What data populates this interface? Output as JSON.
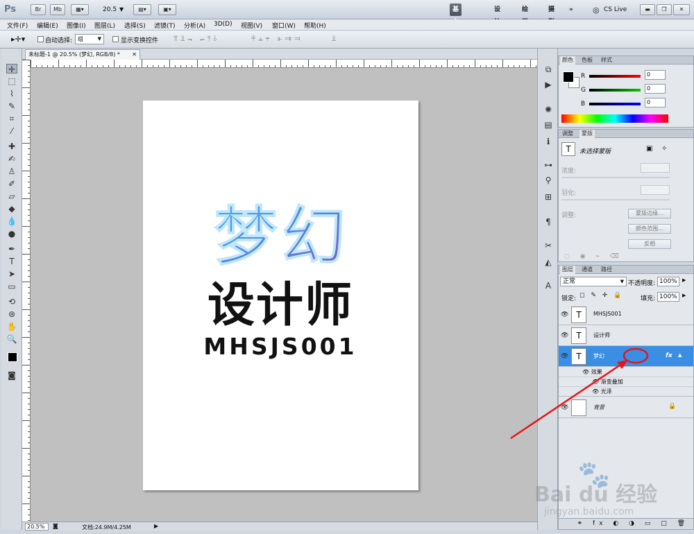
{
  "app": {
    "logo": "Ps",
    "bridge_btn": "Br",
    "minibridge_btn": "Mb",
    "zoom": "20.5",
    "workspaces": [
      "基本功能",
      "设计",
      "绘画",
      "摄影",
      "»"
    ],
    "cslive": "CS Live"
  },
  "menu": [
    "文件(F)",
    "编辑(E)",
    "图像(I)",
    "图层(L)",
    "选择(S)",
    "滤镜(T)",
    "分析(A)",
    "3D(D)",
    "视图(V)",
    "窗口(W)",
    "帮助(H)"
  ],
  "options": {
    "auto_select_label": "自动选择:",
    "auto_select_value": "组",
    "transform_label": "显示变换控件"
  },
  "document": {
    "tab_title": "未标题-1 @ 20.5% (梦幻, RGB/8) *",
    "line1": "梦幻",
    "line2": "设计师",
    "line3": "MHSJS001"
  },
  "status": {
    "zoom": "20.5%",
    "doc_info": "文档:24.9M/4.25M"
  },
  "color_panel": {
    "tabs": [
      "颜色",
      "色板",
      "样式"
    ],
    "channels": [
      {
        "label": "R",
        "value": "0"
      },
      {
        "label": "G",
        "value": "0"
      },
      {
        "label": "B",
        "value": "0"
      }
    ]
  },
  "adjust_panel": {
    "tabs": [
      "调整",
      "蒙版"
    ],
    "title": "未选择蒙版",
    "density": "浓度:",
    "feather": "羽化:",
    "refine": "调整:",
    "mask_edge": "蒙版边缘...",
    "color_range": "颜色范围...",
    "invert": "反相"
  },
  "layers_panel": {
    "tabs": [
      "图层",
      "通道",
      "路径"
    ],
    "blend_mode": "正常",
    "opacity_label": "不透明度:",
    "opacity": "100%",
    "lock_label": "锁定:",
    "fill_label": "填充:",
    "fill": "100%",
    "layers": [
      "MHSJS001",
      "设计师",
      "梦幻"
    ],
    "effects_label": "效果",
    "effects": [
      "渐变叠加",
      "光泽"
    ],
    "background": "背景",
    "fx": "fx"
  },
  "watermark": {
    "brand": "Bai du 经验",
    "url": "jingyan.baidu.com"
  },
  "colors": {
    "selected_layer": "#3a8fe4",
    "annotation": "#e8141c",
    "dream_gradient_start": "#4aa8e8",
    "dream_gradient_end": "#7a54c8"
  }
}
